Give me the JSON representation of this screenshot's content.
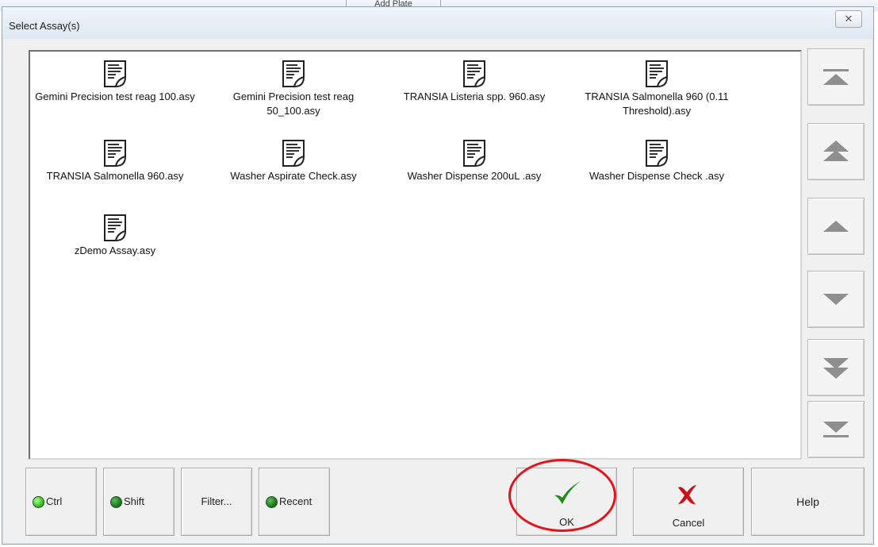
{
  "background": {
    "tab_label": "Add Plate"
  },
  "dialog": {
    "title": "Select Assay(s)",
    "close_icon": "close-icon",
    "close_glyph": "✕"
  },
  "files": [
    {
      "label": "Gemini Precision test reag 100.asy"
    },
    {
      "label": "Gemini Precision test reag 50_100.asy"
    },
    {
      "label": "TRANSIA Listeria spp. 960.asy"
    },
    {
      "label": "TRANSIA Salmonella 960 (0.11 Threshold).asy"
    },
    {
      "label": "TRANSIA Salmonella 960.asy"
    },
    {
      "label": "Washer Aspirate Check.asy"
    },
    {
      "label": "Washer Dispense 200uL .asy"
    },
    {
      "label": "Washer Dispense Check .asy"
    },
    {
      "label": "zDemo Assay.asy"
    }
  ],
  "scroll_buttons": [
    {
      "name": "scroll-top-icon"
    },
    {
      "name": "page-up-icon"
    },
    {
      "name": "line-up-icon"
    },
    {
      "name": "line-down-icon"
    },
    {
      "name": "page-down-icon"
    },
    {
      "name": "scroll-bottom-icon"
    }
  ],
  "buttons": {
    "ctrl": {
      "label": "Ctrl",
      "led": "on"
    },
    "shift": {
      "label": "Shift",
      "led": "off"
    },
    "filter": {
      "label": "Filter..."
    },
    "recent": {
      "label": "Recent",
      "led": "off"
    },
    "ok": {
      "label": "OK",
      "icon": "checkmark-icon"
    },
    "cancel": {
      "label": "Cancel",
      "icon": "x-mark-icon"
    },
    "help": {
      "label": "Help"
    }
  },
  "colors": {
    "ok_check": "#1f8a1f",
    "cancel_x": "#c8101a",
    "highlight_circle": "#e1141c",
    "arrow_gray": "#8f8f8f"
  }
}
